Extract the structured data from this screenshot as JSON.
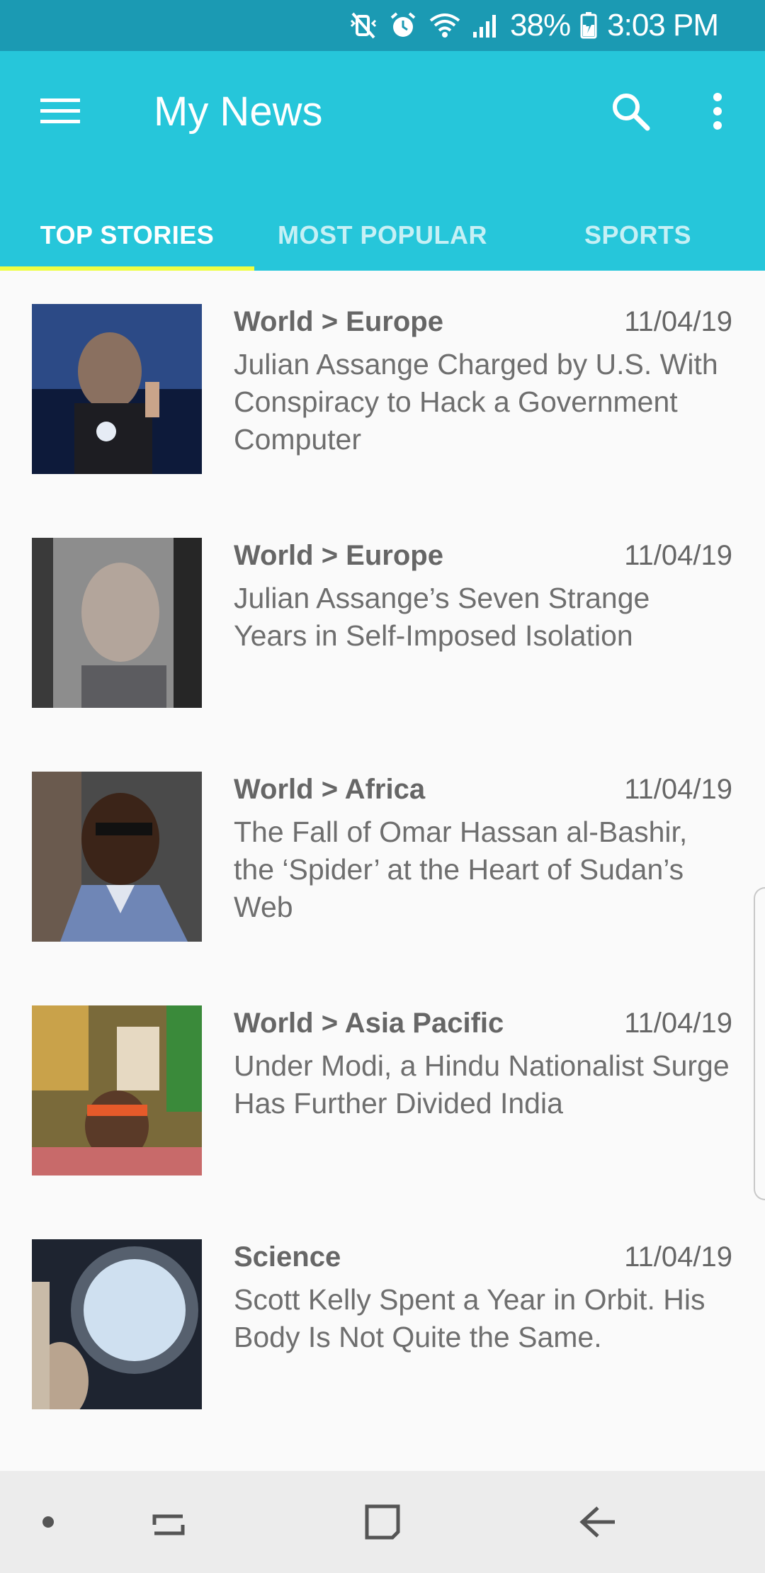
{
  "status_bar": {
    "battery_percent": "38%",
    "time": "3:03 PM",
    "icons": [
      "mute-vibrate-icon",
      "alarm-icon",
      "wifi-icon",
      "signal-icon",
      "battery-icon"
    ]
  },
  "app_bar": {
    "title": "My News",
    "menu_icon": "hamburger-menu-icon",
    "search_icon": "search-icon",
    "more_icon": "more-vertical-icon",
    "background": "#26c6da"
  },
  "tabs": [
    {
      "label": "TOP STORIES",
      "active": true
    },
    {
      "label": "MOST POPULAR",
      "active": false
    },
    {
      "label": "SPORTS",
      "active": false
    }
  ],
  "indicator_color": "#eeff41",
  "articles": [
    {
      "section": "World > Europe",
      "date": "11/04/19",
      "headline": "Julian Assange Charged by U.S. With Conspiracy to Hack a Government Computer"
    },
    {
      "section": "World > Europe",
      "date": "11/04/19",
      "headline": "Julian Assange’s Seven Strange Years in Self-Imposed Isolation"
    },
    {
      "section": "World > Africa",
      "date": "11/04/19",
      "headline": "The Fall of Omar Hassan al-Bashir, the ‘Spider’ at the Heart of Sudan’s Web"
    },
    {
      "section": "World > Asia Pacific",
      "date": "11/04/19",
      "headline": "Under Modi, a Hindu Nationalist Surge Has Further Divided India"
    },
    {
      "section": "Science",
      "date": "11/04/19",
      "headline": "Scott Kelly Spent a Year in Orbit. His Body Is Not Quite the Same."
    }
  ],
  "nav_bar": {
    "buttons": [
      "dot-icon",
      "recents-icon",
      "home-icon",
      "back-icon"
    ]
  }
}
